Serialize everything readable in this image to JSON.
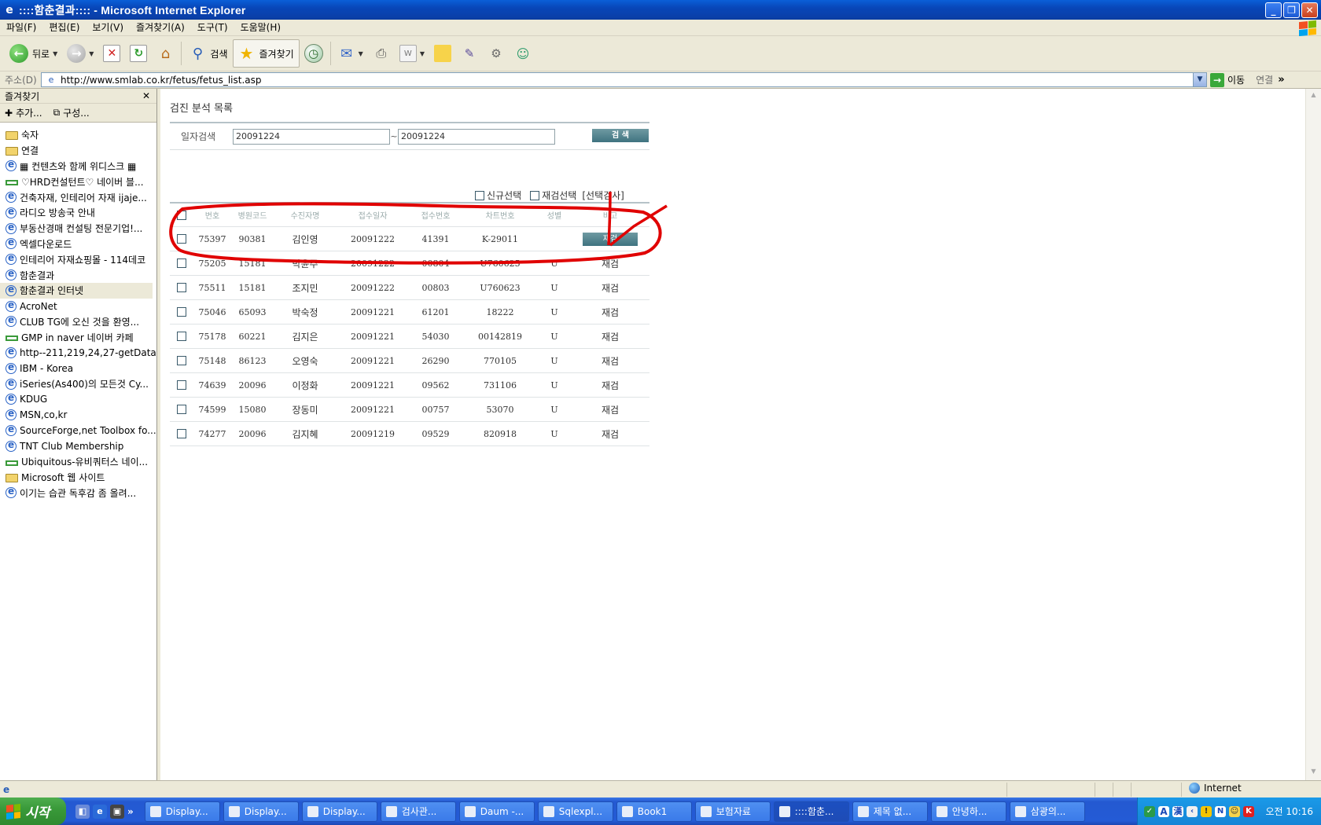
{
  "window": {
    "title": "::::함춘결과:::: - Microsoft Internet Explorer",
    "buttons": [
      "_",
      "❐",
      "✕"
    ]
  },
  "menu": [
    "파일(F)",
    "편집(E)",
    "보기(V)",
    "즐겨찾기(A)",
    "도구(T)",
    "도움말(H)"
  ],
  "toolbar": {
    "back_label": "뒤로",
    "search_label": "검색",
    "favorites_label": "즐겨찾기"
  },
  "address": {
    "label": "주소(D)",
    "url": "http://www.smlab.co.kr/fetus/fetus_list.asp",
    "go_label": "이동",
    "links_label": "연결"
  },
  "favorites": {
    "title": "즐겨찾기",
    "add_label": "추가...",
    "organize_label": "구성...",
    "items": [
      {
        "label": "숙자",
        "icon": "folder-icon"
      },
      {
        "label": "연결",
        "icon": "folder-icon"
      },
      {
        "label": "▦ 컨텐츠와 함께 위디스크 ▦",
        "icon": "ie-page-icon"
      },
      {
        "label": "♡HRD컨설턴트♡ 네이버 블...",
        "icon": "link-icon"
      },
      {
        "label": "건축자재, 인테리어 자재 ijaje...",
        "icon": "ie-page-icon"
      },
      {
        "label": "라디오 방송국 안내",
        "icon": "ie-page-icon"
      },
      {
        "label": "부동산경매 컨설팅 전문기업!...",
        "icon": "ie-page-icon"
      },
      {
        "label": "엑셀다운로드",
        "icon": "ie-page-icon"
      },
      {
        "label": "인테리어 자재쇼핑몰 - 114데코",
        "icon": "ie-page-icon"
      },
      {
        "label": "함춘결과",
        "icon": "ie-page-icon"
      },
      {
        "label": "함춘결과 인터넷",
        "icon": "ie-page-icon"
      },
      {
        "label": "AcroNet",
        "icon": "ie-page-icon"
      },
      {
        "label": "CLUB TG에 오신 것을 환영...",
        "icon": "ie-page-icon"
      },
      {
        "label": "GMP in naver  네이버 카페",
        "icon": "link-icon"
      },
      {
        "label": "http--211,219,24,27-getData-...",
        "icon": "ie-page-icon"
      },
      {
        "label": "IBM - Korea",
        "icon": "ie-page-icon"
      },
      {
        "label": "iSeries(As400)의 모든것 Cy...",
        "icon": "ie-page-icon"
      },
      {
        "label": "KDUG",
        "icon": "ie-page-icon"
      },
      {
        "label": "MSN,co,kr",
        "icon": "ie-page-icon"
      },
      {
        "label": "SourceForge,net Toolbox fo...",
        "icon": "ie-page-icon"
      },
      {
        "label": "TNT Club Membership",
        "icon": "ie-page-icon"
      },
      {
        "label": "Ubiquitous-유비쿼터스  네이...",
        "icon": "link-icon"
      },
      {
        "label": "Microsoft 웹 사이트",
        "icon": "folder-icon"
      },
      {
        "label": "이기는 습관 독후감 좀 올려...",
        "icon": "ie-page-icon"
      }
    ],
    "selected_index": 10
  },
  "page": {
    "title": "검진 분석 목록",
    "search": {
      "label": "일자검색",
      "from": "20091224",
      "tilde": "~",
      "to": "20091224",
      "button": "검 색"
    },
    "selectors": {
      "new_label": "신규선택",
      "retest_label": "재검선택",
      "selected_test_label": "[선택검사]"
    },
    "table": {
      "headers": [
        "번호",
        "병원코드",
        "수진자명",
        "접수일자",
        "접수번호",
        "차트번호",
        "성별",
        "비고"
      ],
      "rows": [
        {
          "no": "75397",
          "code": "90381",
          "name": "김인영",
          "date": "20091222",
          "receipt": "41391",
          "chart": "K-29011",
          "sex": "",
          "note": "재검",
          "button": true
        },
        {
          "no": "75205",
          "code": "15181",
          "name": "박윤주",
          "date": "20091222",
          "receipt": "00804",
          "chart": "U760625",
          "sex": "U",
          "note": "재검",
          "button": false
        },
        {
          "no": "75511",
          "code": "15181",
          "name": "조지민",
          "date": "20091222",
          "receipt": "00803",
          "chart": "U760623",
          "sex": "U",
          "note": "재검",
          "button": false
        },
        {
          "no": "75046",
          "code": "65093",
          "name": "박숙정",
          "date": "20091221",
          "receipt": "61201",
          "chart": "18222",
          "sex": "U",
          "note": "재검",
          "button": false
        },
        {
          "no": "75178",
          "code": "60221",
          "name": "김지은",
          "date": "20091221",
          "receipt": "54030",
          "chart": "00142819",
          "sex": "U",
          "note": "재검",
          "button": false
        },
        {
          "no": "75148",
          "code": "86123",
          "name": "오영숙",
          "date": "20091221",
          "receipt": "26290",
          "chart": "770105",
          "sex": "U",
          "note": "재검",
          "button": false
        },
        {
          "no": "74639",
          "code": "20096",
          "name": "이정화",
          "date": "20091221",
          "receipt": "09562",
          "chart": "731106",
          "sex": "U",
          "note": "재검",
          "button": false
        },
        {
          "no": "74599",
          "code": "15080",
          "name": "장동미",
          "date": "20091221",
          "receipt": "00757",
          "chart": "53070",
          "sex": "U",
          "note": "재검",
          "button": false
        },
        {
          "no": "74277",
          "code": "20096",
          "name": "김지혜",
          "date": "20091219",
          "receipt": "09529",
          "chart": "820918",
          "sex": "U",
          "note": "재검",
          "button": false
        }
      ]
    }
  },
  "status": {
    "zone": "Internet"
  },
  "taskbar": {
    "start_label": "시작",
    "tasks": [
      "Display...",
      "Display...",
      "Display...",
      "검사관...",
      "Daum -...",
      "Sqlexpl...",
      "Book1",
      "보험자료",
      "::::함춘...",
      "제목 없...",
      "안녕하...",
      "삼광의..."
    ],
    "active_index": 8,
    "clock": "오전 10:16"
  },
  "colors": {
    "xp_blue": "#0a5fd8",
    "table_button": "#3f7380",
    "annotation_red": "#e00000"
  }
}
